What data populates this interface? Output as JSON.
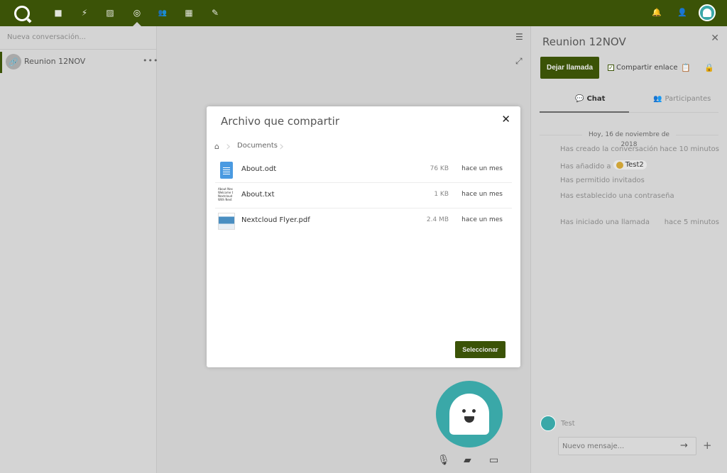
{
  "header": {
    "apps": [
      {
        "name": "files-icon",
        "glyph": "■"
      },
      {
        "name": "activity-icon",
        "glyph": "⚡"
      },
      {
        "name": "gallery-icon",
        "glyph": "▨"
      },
      {
        "name": "talk-icon",
        "glyph": "◎"
      },
      {
        "name": "contacts-icon",
        "glyph": "👥"
      },
      {
        "name": "calendar-icon",
        "glyph": "▦"
      },
      {
        "name": "notes-icon",
        "glyph": "✎"
      }
    ],
    "colors": {
      "bar": "#3b5307",
      "accent_avatar": "#3aa8a8"
    }
  },
  "left": {
    "new_conversation_placeholder": "Nueva conversación...",
    "conversation": {
      "name": "Reunion 12NOV",
      "more": "•••"
    }
  },
  "right": {
    "title": "Reunion 12NOV",
    "leave_call": "Dejar llamada",
    "share_link": "Compartir enlace",
    "share_link_checked": true,
    "tabs": {
      "chat": "Chat",
      "participants": "Participantes"
    },
    "day_separator": "Hoy, 16 de noviembre de 2018",
    "messages": [
      {
        "text": "Has creado la conversación",
        "time": "hace 10 minutos"
      },
      {
        "text_prefix": "Has añadido a",
        "mention": "Test2",
        "time": ""
      },
      {
        "text": "Has permitido invitados",
        "time": ""
      },
      {
        "text": "Has establecido una contraseña",
        "time": ""
      },
      {
        "text": "Has iniciado una llamada",
        "time": "hace 5 minutos"
      }
    ],
    "composer": {
      "user": "Test",
      "placeholder": "Nuevo mensaje..."
    }
  },
  "modal": {
    "title": "Archivo que compartir",
    "breadcrumb": "Documents",
    "files": [
      {
        "name": "About.odt",
        "size": "76 KB",
        "date": "hace un mes",
        "icon": "document-icon"
      },
      {
        "name": "About.txt",
        "size": "1 KB",
        "date": "hace un mes",
        "icon": "text-preview-icon"
      },
      {
        "name": "Nextcloud Flyer.pdf",
        "size": "2.4 MB",
        "date": "hace un mes",
        "icon": "pdf-preview-icon"
      }
    ],
    "txt_preview": "About Nex Welcome t Nextcloud With Next",
    "select_button": "Seleccionar"
  }
}
